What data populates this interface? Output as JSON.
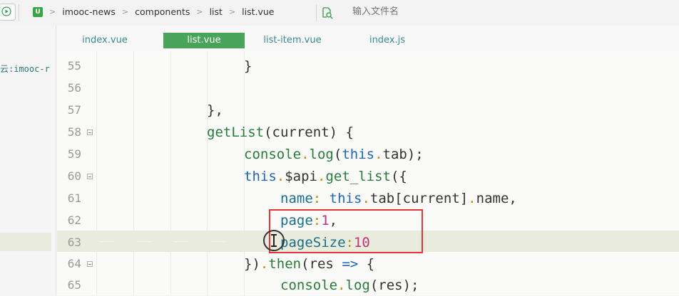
{
  "toolbar": {
    "crumb_logo": "U",
    "breadcrumb": [
      "imooc-news",
      "components",
      "list",
      "list.vue"
    ],
    "search_placeholder": "输入文件名"
  },
  "sidebar": {
    "project_label": "云:imooc-r"
  },
  "tabs": [
    {
      "label": "index.vue",
      "active": false
    },
    {
      "label": "list.vue",
      "active": true
    },
    {
      "label": "list-item.vue",
      "active": false
    },
    {
      "label": "index.js",
      "active": false
    }
  ],
  "editor": {
    "current_line": 63,
    "lines": [
      {
        "n": "55",
        "fold": false,
        "text": "}"
      },
      {
        "n": "56",
        "fold": false,
        "text": ""
      },
      {
        "n": "57",
        "fold": false,
        "text": "},"
      },
      {
        "n": "58",
        "fold": true,
        "text": "getList(current) {"
      },
      {
        "n": "59",
        "fold": false,
        "text": "console.log(this.tab);"
      },
      {
        "n": "60",
        "fold": true,
        "text": "this.$api.get_list({"
      },
      {
        "n": "61",
        "fold": false,
        "text": "name: this.tab[current].name,"
      },
      {
        "n": "62",
        "fold": false,
        "text": "page:1,"
      },
      {
        "n": "63",
        "fold": false,
        "text": "pageSize:10"
      },
      {
        "n": "64",
        "fold": true,
        "text": "}).then(res => {"
      },
      {
        "n": "65",
        "fold": false,
        "text": "console.log(res);"
      }
    ]
  },
  "colors": {
    "active_tab": "#4aa35a",
    "keyword": "#1f66b8",
    "property": "#1b6e88",
    "number": "#c0327a",
    "highlight_box": "#e3343a"
  }
}
